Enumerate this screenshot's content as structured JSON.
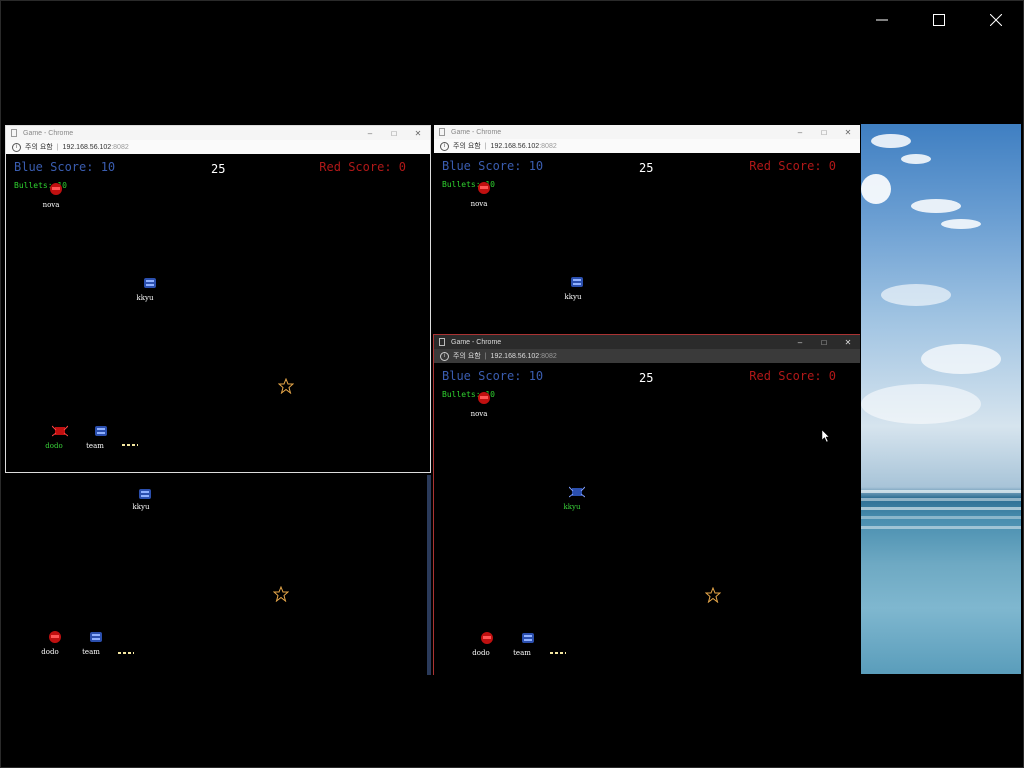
{
  "outer_window": {
    "controls": [
      "minimize-icon",
      "maximize-icon",
      "close-icon"
    ]
  },
  "browser": {
    "title": "Game - Chrome",
    "security_label": "주의 요함",
    "host": "192.168.56.102",
    "port": ":8082"
  },
  "game": {
    "blue_score": "Blue Score: 10",
    "red_score": "Red Score: 0",
    "timer": "25",
    "bullets": "Bullets: 10",
    "players": {
      "nova": "nova",
      "kkyu": "kkyu",
      "dodo": "dodo",
      "team": "team"
    }
  },
  "colors": {
    "blue": "#3a5db0",
    "red": "#b01818",
    "bullets": "#2fd22f",
    "star": "#e8a84a",
    "background": "#000000"
  }
}
